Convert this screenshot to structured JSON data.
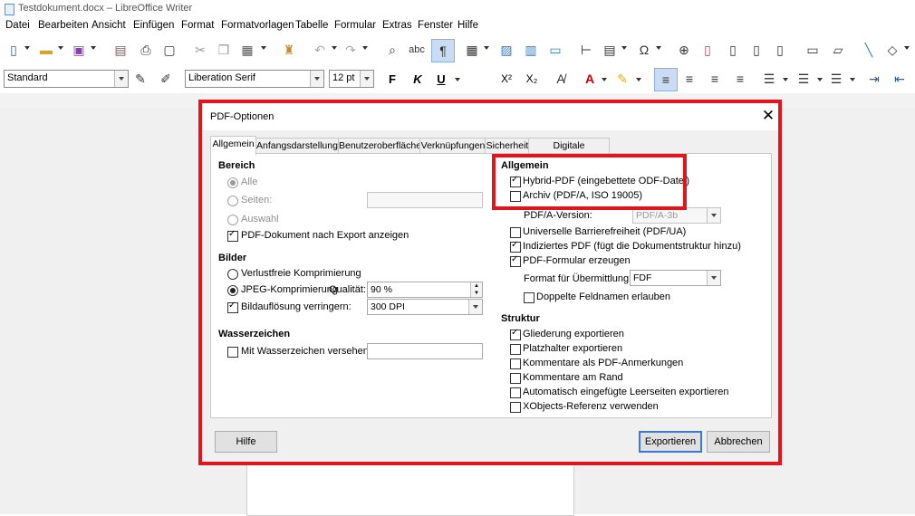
{
  "window": {
    "title": "Testdokument.docx – LibreOffice Writer"
  },
  "menu": [
    "Datei",
    "Bearbeiten",
    "Ansicht",
    "Einfügen",
    "Format",
    "Formatvorlagen",
    "Tabelle",
    "Formular",
    "Extras",
    "Fenster",
    "Hilfe"
  ],
  "formatbar": {
    "style": "Standard",
    "font": "Liberation Serif",
    "size": "12 pt",
    "bold": "F",
    "italic": "K",
    "underline": "U",
    "superscript": "X²",
    "subscript": "X₂"
  },
  "dialog": {
    "title": "PDF-Optionen",
    "tabs": [
      "Allgemein",
      "Anfangsdarstellung",
      "Benutzeroberfläche",
      "Verknüpfungen",
      "Sicherheit",
      "Digitale Signaturen"
    ],
    "bereich": {
      "heading": "Bereich",
      "alle": "Alle",
      "seiten": "Seiten:",
      "auswahl": "Auswahl",
      "pdf_anzeigen": "PDF-Dokument nach Export anzeigen"
    },
    "bilder": {
      "heading": "Bilder",
      "verlustfrei": "Verlustfreie Komprimierung",
      "jpeg": "JPEG-Komprimierung",
      "qualitaet_label": "Qualität:",
      "qualitaet_value": "90 %",
      "aufloesung": "Bildauflösung verringern:",
      "dpi_value": "300 DPI"
    },
    "wasserzeichen": {
      "heading": "Wasserzeichen",
      "versehen": "Mit Wasserzeichen versehen:"
    },
    "allgemein": {
      "heading": "Allgemein",
      "hybrid": "Hybrid-PDF (eingebettete ODF-Datei)",
      "archiv": "Archiv (PDF/A, ISO 19005)",
      "pdfa_label": "PDF/A-Version:",
      "pdfa_value": "PDF/A-3b",
      "barrierefrei": "Universelle Barrierefreiheit (PDF/UA)",
      "indiziert": "Indiziertes PDF (fügt die Dokumentstruktur hinzu)",
      "formular": "PDF-Formular erzeugen",
      "format_label": "Format für Übermittlung:",
      "format_value": "FDF",
      "doppelte": "Doppelte Feldnamen erlauben"
    },
    "struktur": {
      "heading": "Struktur",
      "gliederung": "Gliederung exportieren",
      "platzhalter": "Platzhalter exportieren",
      "kommentare_pdf": "Kommentare als PDF-Anmerkungen",
      "kommentare_rand": "Kommentare am Rand",
      "leerseiten": "Automatisch eingefügte Leerseiten exportieren",
      "xobjects": "XObjects-Referenz verwenden"
    },
    "buttons": {
      "hilfe": "Hilfe",
      "exportieren": "Exportieren",
      "abbrechen": "Abbrechen"
    }
  },
  "colors": {
    "highlight": "#e0161f",
    "accent": "#3a78d4"
  }
}
